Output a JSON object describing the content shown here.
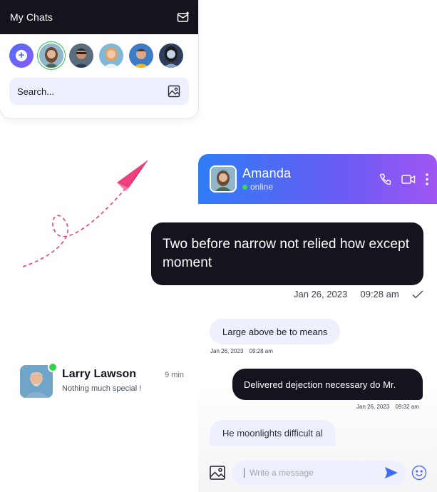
{
  "chats_card": {
    "title": "My Chats",
    "search_label": "Search...",
    "add_story_symbol": "+"
  },
  "contact": {
    "name": "Larry Lawson",
    "time": "9 min",
    "preview": "Nothing much special !"
  },
  "chat": {
    "name": "Amanda",
    "status": "online",
    "messages": [
      {
        "direction": "out",
        "text": "Two before narrow not relied how except moment",
        "date": "Jan 26, 2023",
        "time": "09:28 am"
      },
      {
        "direction": "in",
        "text": "Large above be to means",
        "date": "Jan 26, 2023",
        "time": "09:28 am"
      },
      {
        "direction": "out",
        "text": "Delivered dejection necessary do Mr.",
        "date": "Jan 26, 2023",
        "time": "09:32 am"
      },
      {
        "direction": "in",
        "text": "He moonlights difficult al"
      }
    ],
    "composer_placeholder": "Write a message"
  },
  "colors": {
    "dark": "#14141f",
    "accent_blue": "#2f7cf5",
    "accent_purple": "#a055f2",
    "bubble_light": "#eef0ff",
    "online_green": "#35d24c",
    "plane_pink": "#ef3f7f"
  },
  "icons": [
    "compose-icon",
    "image-icon",
    "phone-icon",
    "video-icon",
    "more-icon",
    "check-icon",
    "send-icon",
    "emoji-icon",
    "paper-plane-icon"
  ]
}
